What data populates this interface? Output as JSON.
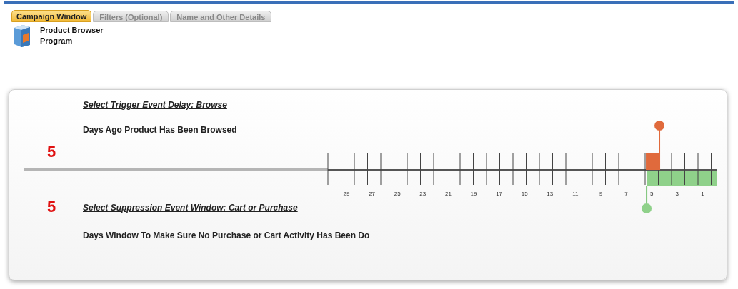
{
  "tabs": [
    {
      "label": "Campaign Window",
      "selected": true
    },
    {
      "label": "Filters (Optional)",
      "selected": false
    },
    {
      "label": "Name and Other Details",
      "selected": false
    }
  ],
  "program": {
    "title": "Product Browser Program"
  },
  "trigger": {
    "heading": "Select Trigger Event Delay: Browse",
    "description": "Days Ago Product Has Been Browsed",
    "value": "5",
    "level": 0.853
  },
  "suppression": {
    "heading": "Select Suppression Event Window: Cart or Purchase",
    "description": "Days Window To Make Sure No Purchase or Cart Activity Has Been Do",
    "value": "5",
    "level": 0.18
  },
  "scale_labels": [
    "29",
    "27",
    "25",
    "23",
    "21",
    "19",
    "17",
    "15",
    "13",
    "11",
    "9",
    "7",
    "5",
    "3",
    "1"
  ]
}
